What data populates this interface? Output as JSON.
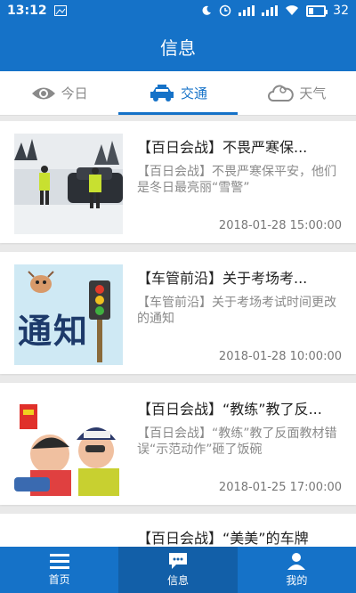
{
  "status_bar": {
    "time": "13:12",
    "battery": "32"
  },
  "app_bar": {
    "title": "信息"
  },
  "tabs": [
    {
      "label": "今日",
      "icon": "eye-icon"
    },
    {
      "label": "交通",
      "icon": "car-icon"
    },
    {
      "label": "天气",
      "icon": "cloud-icon"
    }
  ],
  "articles": [
    {
      "title": "【百日会战】不畏严寒保...",
      "summary": "【百日会战】不畏严寒保平安，他们是冬日最亮丽“雪警”",
      "date": "2018-01-28 15:00:00"
    },
    {
      "title": "【车管前沿】关于考场考...",
      "summary": "【车管前沿】关于考场考试时间更改的通知",
      "date": "2018-01-28 10:00:00",
      "image_text": "通知"
    },
    {
      "title": "【百日会战】“教练”教了反...",
      "summary": "【百日会战】“教练”教了反面教材错误“示范动作”砸了饭碗",
      "date": "2018-01-25 17:00:00"
    },
    {
      "title": "【百日会战】“美美”的车牌"
    }
  ],
  "bottom_nav": [
    {
      "label": "首页",
      "icon": "menu-icon"
    },
    {
      "label": "信息",
      "icon": "message-icon"
    },
    {
      "label": "我的",
      "icon": "user-icon"
    }
  ],
  "colors": {
    "primary": "#1572c8",
    "active_nav": "#125fa8"
  }
}
